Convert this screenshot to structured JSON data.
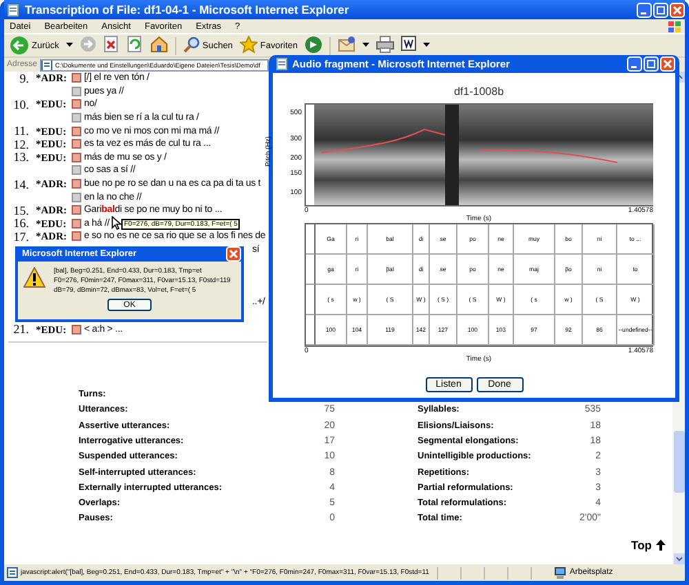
{
  "window": {
    "title": "Transcription of File: df1-04-1 - Microsoft Internet Explorer"
  },
  "menu": [
    "Datei",
    "Bearbeiten",
    "Ansicht",
    "Favoriten",
    "Extras",
    "?"
  ],
  "toolbar": [
    {
      "kind": "back",
      "label": "Zurück"
    },
    {
      "kind": "forward"
    },
    {
      "kind": "stop"
    },
    {
      "kind": "refresh"
    },
    {
      "kind": "home"
    },
    {
      "kind": "search",
      "label": "Suchen"
    },
    {
      "kind": "favorites",
      "label": "Favoriten"
    },
    {
      "kind": "media"
    },
    {
      "kind": "mail"
    },
    {
      "kind": "print"
    },
    {
      "kind": "edit"
    }
  ],
  "address": {
    "label": "Adresse",
    "value": "C:\\Dokumente und Einstellungen\\Eduardo\\Eigene Dateien\\Tesis\\Demo\\df"
  },
  "transcript": [
    {
      "kind": "turn",
      "number": "9.",
      "speaker": "*ADR:",
      "text": "[/] el re ven tón /"
    },
    {
      "kind": "continuation",
      "text": "pues ya //"
    },
    {
      "kind": "turn",
      "number": "10.",
      "speaker": "*EDU:",
      "text": "no/"
    },
    {
      "kind": "continuation",
      "text": "más bien se rí a la cul tu ra /"
    },
    {
      "kind": "turn",
      "number": "11.",
      "speaker": "*EDU:",
      "text": "co mo ve ni mos con mi ma má //"
    },
    {
      "kind": "turn",
      "number": "12.",
      "speaker": "*EDU:",
      "text": "es ta vez es más de cul tu ra ..."
    },
    {
      "kind": "turn",
      "number": "13.",
      "speaker": "*EDU:",
      "text": "más de mu se os y /"
    },
    {
      "kind": "continuation",
      "text": "co sas a sí //"
    },
    {
      "kind": "turn",
      "number": "14.",
      "speaker": "*ADR:",
      "text": "bue no pe ro se dan u na es ca pa di ta us t"
    },
    {
      "kind": "continuation",
      "text": "en la no che //"
    },
    {
      "kind": "turn",
      "number": "15.",
      "speaker": "*ADR:",
      "text": "Gari",
      "highlight": "bal",
      "after": "di se po ne muy bo ni to ..."
    },
    {
      "kind": "turn",
      "number": "16.",
      "speaker": "*EDU:",
      "text": "a há //"
    },
    {
      "kind": "turn",
      "number": "17.",
      "speaker": "*ADR:",
      "text": "e so no es ne ce sa rio que se a los fi nes de"
    },
    {
      "kind": "fragment",
      "text": "sí"
    },
    {
      "kind": "covered"
    },
    {
      "kind": "covered"
    },
    {
      "kind": "covered"
    },
    {
      "kind": "fragment",
      "text": "..+/"
    },
    {
      "kind": "covered"
    },
    {
      "kind": "turn",
      "number": "21.",
      "speaker": "*EDU:",
      "text": "< a:h > ..."
    }
  ],
  "tooltip": {
    "text": "F0=276, dB=79, Dur=0.183, F=et=( 5"
  },
  "alert": {
    "title": "Microsoft Internet Explorer",
    "lines": [
      "[bal], Beg=0.251, End=0.433, Dur=0.183, Tmp=et",
      "F0=276, F0min=247, F0max=311, F0var=15.13, F0std=119",
      "dB=79, dBmin=72, dBmax=83, Vol=et, F=et=( 5"
    ],
    "button": "OK"
  },
  "stats_left": [
    {
      "label": "Turns:"
    },
    {
      "label": "Utterances:",
      "value": "75"
    },
    {
      "label": "Assertive utterances:",
      "value": "20"
    },
    {
      "label": "Interrogative utterances:",
      "value": "17"
    },
    {
      "label": "Suspended utterances:",
      "value": "10"
    },
    {
      "label": "Self-interrupted utterances:",
      "value": "8"
    },
    {
      "label": "Externally interrupted utterances:",
      "value": "4"
    },
    {
      "label": "Overlaps:",
      "value": "5"
    },
    {
      "label": "Pauses:",
      "value": "0"
    }
  ],
  "stats_right": [
    {
      "label": "Syllables:",
      "value": "535"
    },
    {
      "label": "Elisions/Liaisons:",
      "value": "18"
    },
    {
      "label": "Segmental elongations:",
      "value": "18"
    },
    {
      "label": "Unintelligible productions:",
      "value": "2"
    },
    {
      "label": "Repetitions:",
      "value": "3"
    },
    {
      "label": "Partial reformulations:",
      "value": "3"
    },
    {
      "label": "Total reformulations:",
      "value": "4"
    },
    {
      "label": "Total time:",
      "value": "2'00\""
    }
  ],
  "top_link": "Top",
  "status_bar": {
    "text": "javascript:alert(\"[bal], Beg=0.251, End=0.433, Dur=0.183, Tmp=et\" + \"\\n\" + \"F0=276, F0min=247, F0max=311, F0var=15.13, F0std=11",
    "zone": "Arbeitsplatz"
  },
  "popup": {
    "title": "Audio fragment - Microsoft Internet Explorer",
    "plot_title": "df1-1008b",
    "y_label": "Pitch (Hz)",
    "y_ticks": [
      "500",
      "300",
      "200",
      "150",
      "100"
    ],
    "top_axis": {
      "start": "0",
      "end": "1.40578",
      "label": "Time (s)"
    },
    "rows": [
      [
        "Ga",
        "ri",
        "bal",
        "di",
        "se",
        "po",
        "ne",
        "muy",
        "bo",
        "ni",
        "to ..."
      ],
      [
        "ga",
        "ri",
        "βal",
        "di",
        "se",
        "po",
        "ne",
        "maj",
        "βo",
        "ni",
        "to"
      ],
      [
        "( s",
        "w )",
        "( S",
        "W )",
        "( S )",
        "( S",
        "W )",
        "( s",
        "w )",
        "( S",
        "W )"
      ],
      [
        "100",
        "104",
        "119",
        "142",
        "127",
        "100",
        "103",
        "97",
        "92",
        "86",
        "--undefined--"
      ]
    ],
    "bottom_axis": {
      "start": "0",
      "end": "1.40578",
      "label": "Time (s)"
    },
    "buttons": [
      "Listen",
      "Done"
    ]
  }
}
